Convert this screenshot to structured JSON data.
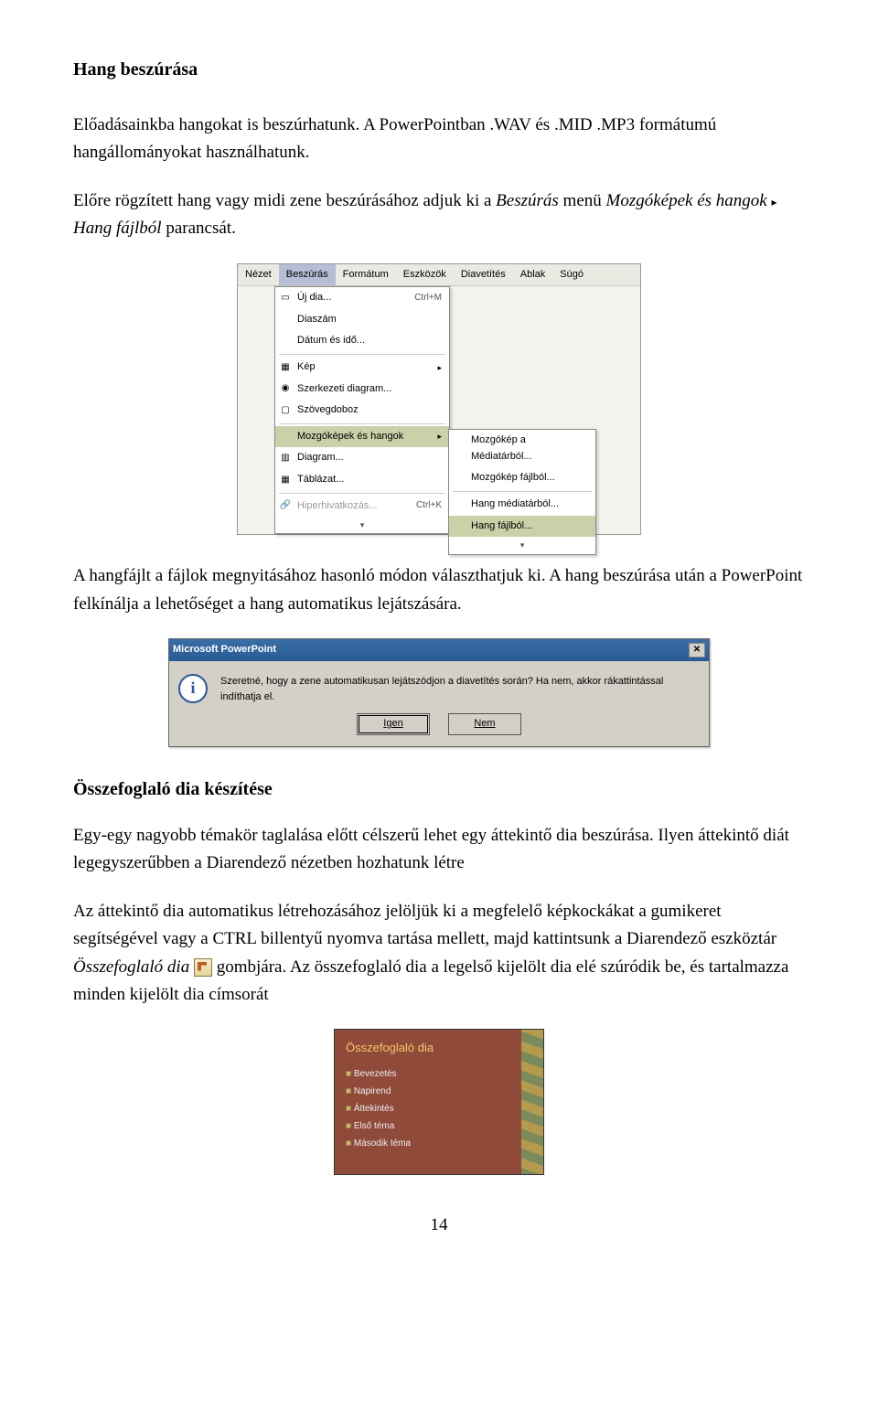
{
  "headings": {
    "h1": "Hang beszúrása",
    "h2": "Összefoglaló dia készítése"
  },
  "paragraphs": {
    "p1a": "Előadásainkba hangokat is beszúrhatunk. A PowerPointban .WAV és .MID .MP3 formátumú hangállományokat használhatunk.",
    "p2a": "Előre rögzített hang vagy midi zene beszúrásához adjuk ki a ",
    "p2b": "Beszúrás",
    "p2c": " menü ",
    "p2d": "Mozgóképek és hangok",
    "p2e": "Hang fájlból",
    "p2f": " parancsát.",
    "p3": "A hangfájlt a fájlok megnyitásához hasonló módon választhatjuk ki. A hang beszúrása után a PowerPoint felkínálja a lehetőséget a hang automatikus lejátszására.",
    "p4": "Egy-egy nagyobb témakör taglalása előtt célszerű lehet egy áttekintő dia beszúrása. Ilyen áttekintő diát legegyszerűbben a Diarendező nézetben hozhatunk létre",
    "p5": "Az áttekintő dia automatikus létrehozásához jelöljük ki a megfelelő képkockákat a gumikeret segítségével vagy a CTRL billentyű nyomva tartása mellett, majd kattintsunk a Diarendező eszköztár ",
    "p5b": "Összefoglaló dia",
    "p5c": "gombjára. Az összefoglaló dia a legelső kijelölt dia elé szúródik be, és tartalmazza minden kijelölt dia címsorát"
  },
  "menu": {
    "bar": [
      "Nézet",
      "Beszúrás",
      "Formátum",
      "Eszközök",
      "Diavetítés",
      "Ablak",
      "Súgó"
    ],
    "items": {
      "new_slide": "Új dia...",
      "new_slide_sc": "Ctrl+M",
      "slide_num": "Diaszám",
      "date_time": "Dátum és idő...",
      "picture": "Kép",
      "diagram_struct": "Szerkezeti diagram...",
      "textbox": "Szövegdoboz",
      "movies": "Mozgóképek és hangok",
      "diagram": "Diagram...",
      "table": "Táblázat...",
      "hyperlink": "Hiperhivatkozás...",
      "hyperlink_sc": "Ctrl+K"
    },
    "sub": {
      "clip_movie": "Mozgókép a Médiatárból...",
      "file_movie": "Mozgókép fájlból...",
      "clip_sound": "Hang médiatárból...",
      "file_sound": "Hang fájlból..."
    }
  },
  "dialog": {
    "title": "Microsoft PowerPoint",
    "msg": "Szeretné, hogy a zene automatikusan lejátszódjon a diavetítés során? Ha nem, akkor rákattintással indíthatja el.",
    "yes": "Igen",
    "no": "Nem"
  },
  "slide": {
    "title": "Összefoglaló dia",
    "bullets": [
      "Bevezetés",
      "Napirend",
      "Áttekintés",
      "Első téma",
      "Második téma"
    ]
  },
  "page_number": "14"
}
